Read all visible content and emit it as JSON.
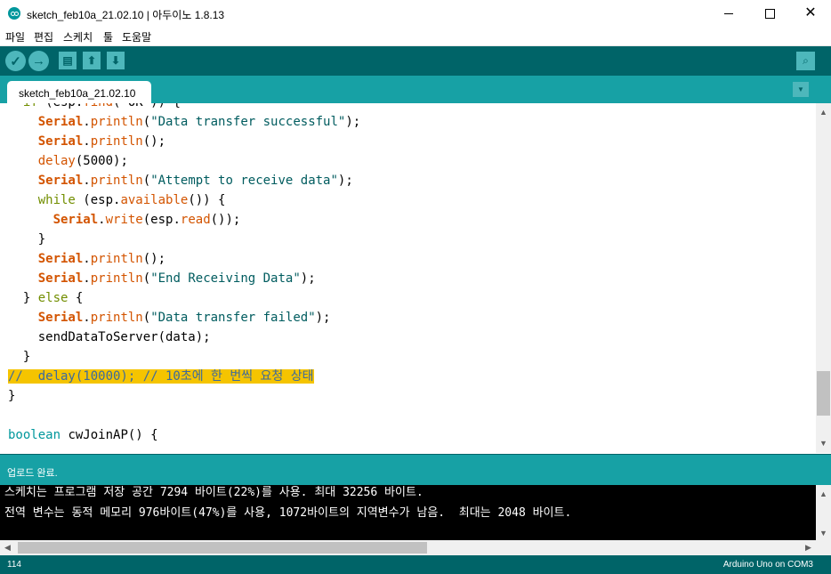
{
  "window": {
    "title": "sketch_feb10a_21.02.10 | 아두이노 1.8.13",
    "minimize_icon": "minimize-icon",
    "maximize_icon": "maximize-icon",
    "close_icon": "close-icon",
    "close_glyph": "✕"
  },
  "menu": [
    "파일",
    "편집",
    "스케치",
    "툴",
    "도움말"
  ],
  "toolbar": {
    "verify_glyph": "✓",
    "upload_glyph": "→",
    "new_glyph": "▤",
    "open_glyph": "⬆",
    "save_glyph": "⬇",
    "serial_glyph": "⌕",
    "accent": "#006468"
  },
  "tabs": {
    "active": "sketch_feb10a_21.02.10",
    "menu_glyph": "▼"
  },
  "editor": {
    "lines": [
      [
        [
          "  ",
          ""
        ],
        [
          "if",
          "kw"
        ],
        [
          " (esp.",
          ""
        ],
        [
          "find",
          "fn"
        ],
        [
          "(\"OK\")) {",
          ""
        ]
      ],
      [
        [
          "    ",
          ""
        ],
        [
          "Serial",
          "obj"
        ],
        [
          ".",
          ""
        ],
        [
          "println",
          "fn"
        ],
        [
          "(",
          ""
        ],
        [
          "\"Data transfer successful\"",
          "str"
        ],
        [
          ");",
          ""
        ]
      ],
      [
        [
          "    ",
          ""
        ],
        [
          "Serial",
          "obj"
        ],
        [
          ".",
          ""
        ],
        [
          "println",
          "fn"
        ],
        [
          "();",
          ""
        ]
      ],
      [
        [
          "    ",
          ""
        ],
        [
          "delay",
          "fn"
        ],
        [
          "(5000);",
          ""
        ]
      ],
      [
        [
          "    ",
          ""
        ],
        [
          "Serial",
          "obj"
        ],
        [
          ".",
          ""
        ],
        [
          "println",
          "fn"
        ],
        [
          "(",
          ""
        ],
        [
          "\"Attempt to receive data\"",
          "str"
        ],
        [
          ");",
          ""
        ]
      ],
      [
        [
          "    ",
          ""
        ],
        [
          "while",
          "kw"
        ],
        [
          " (esp.",
          ""
        ],
        [
          "available",
          "fn"
        ],
        [
          "()) {",
          ""
        ]
      ],
      [
        [
          "      ",
          ""
        ],
        [
          "Serial",
          "obj"
        ],
        [
          ".",
          ""
        ],
        [
          "write",
          "fn"
        ],
        [
          "(esp.",
          ""
        ],
        [
          "read",
          "fn"
        ],
        [
          "());",
          ""
        ]
      ],
      [
        [
          "    }",
          ""
        ]
      ],
      [
        [
          "    ",
          ""
        ],
        [
          "Serial",
          "obj"
        ],
        [
          ".",
          ""
        ],
        [
          "println",
          "fn"
        ],
        [
          "();",
          ""
        ]
      ],
      [
        [
          "    ",
          ""
        ],
        [
          "Serial",
          "obj"
        ],
        [
          ".",
          ""
        ],
        [
          "println",
          "fn"
        ],
        [
          "(",
          ""
        ],
        [
          "\"End Receiving Data\"",
          "str"
        ],
        [
          ");",
          ""
        ]
      ],
      [
        [
          "  } ",
          ""
        ],
        [
          "else",
          "kw"
        ],
        [
          " {",
          ""
        ]
      ],
      [
        [
          "    ",
          ""
        ],
        [
          "Serial",
          "obj"
        ],
        [
          ".",
          ""
        ],
        [
          "println",
          "fn"
        ],
        [
          "(",
          ""
        ],
        [
          "\"Data transfer failed\"",
          "str"
        ],
        [
          ");",
          ""
        ]
      ],
      [
        [
          "    sendDataToServer(data);",
          ""
        ]
      ],
      [
        [
          "  }",
          ""
        ]
      ],
      [
        [
          "//  delay(10000); // 10초에 한 번씩 요청 상태",
          "cmhl"
        ]
      ],
      [
        [
          "}",
          ""
        ]
      ],
      [
        [
          "",
          ""
        ]
      ],
      [
        [
          "boolean",
          "ty"
        ],
        [
          " cwJoinAP() {",
          ""
        ]
      ]
    ]
  },
  "status": {
    "message": "업로드 완료."
  },
  "console": {
    "lines": [
      "스케치는 프로그램 저장 공간 7294 바이트(22%)를 사용. 최대 32256 바이트.",
      "전역 변수는 동적 메모리 976바이트(47%)를 사용, 1072바이트의 지역변수가 남음.  최대는 2048 바이트."
    ]
  },
  "footer": {
    "line_number": "114",
    "board": "Arduino Uno on COM3"
  }
}
